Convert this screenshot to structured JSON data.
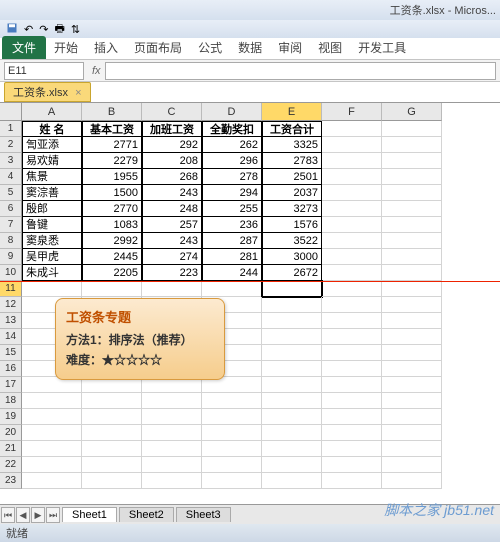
{
  "window": {
    "title": "工资条.xlsx - Micros..."
  },
  "ribbon": {
    "file": "文件",
    "tabs": [
      "开始",
      "插入",
      "页面布局",
      "公式",
      "数据",
      "审阅",
      "视图",
      "开发工具"
    ]
  },
  "namebox": "E11",
  "fx": "fx",
  "workbook_tab": "工资条.xlsx",
  "columns": [
    "A",
    "B",
    "C",
    "D",
    "E",
    "F",
    "G"
  ],
  "headers": [
    "姓  名",
    "基本工资",
    "加班工资",
    "全勤奖扣",
    "工资合计"
  ],
  "rows": [
    {
      "n": "訇亚添",
      "a": 2771,
      "b": 292,
      "c": 262,
      "d": 3325
    },
    {
      "n": "易欢婧",
      "a": 2279,
      "b": 208,
      "c": 296,
      "d": 2783
    },
    {
      "n": "焦景",
      "a": 1955,
      "b": 268,
      "c": 278,
      "d": 2501
    },
    {
      "n": "窦淙善",
      "a": 1500,
      "b": 243,
      "c": 294,
      "d": 2037
    },
    {
      "n": "殷郎",
      "a": 2770,
      "b": 248,
      "c": 255,
      "d": 3273
    },
    {
      "n": "鲁键",
      "a": 1083,
      "b": 257,
      "c": 236,
      "d": 1576
    },
    {
      "n": "窦泉悉",
      "a": 2992,
      "b": 243,
      "c": 287,
      "d": 3522
    },
    {
      "n": "吴甲虎",
      "a": 2445,
      "b": 274,
      "c": 281,
      "d": 3000
    },
    {
      "n": "朱成斗",
      "a": 2205,
      "b": 223,
      "c": 244,
      "d": 2672
    }
  ],
  "note": {
    "title": "工资条专题",
    "l1": "方法1：排序法（推荐）",
    "l2": "难度：★☆☆☆☆"
  },
  "sheets": [
    "Sheet1",
    "Sheet2",
    "Sheet3"
  ],
  "status": "就绪",
  "watermark": "脚本之家 jb51.net",
  "selected": {
    "col": "E",
    "row": 11
  },
  "chart_data": {
    "type": "table",
    "title": "工资条",
    "columns": [
      "姓名",
      "基本工资",
      "加班工资",
      "全勤奖扣",
      "工资合计"
    ],
    "data": [
      [
        "訇亚添",
        2771,
        292,
        262,
        3325
      ],
      [
        "易欢婧",
        2279,
        208,
        296,
        2783
      ],
      [
        "焦景",
        1955,
        268,
        278,
        2501
      ],
      [
        "窦淙善",
        1500,
        243,
        294,
        2037
      ],
      [
        "殷郎",
        2770,
        248,
        255,
        3273
      ],
      [
        "鲁键",
        1083,
        257,
        236,
        1576
      ],
      [
        "窦泉悉",
        2992,
        243,
        287,
        3522
      ],
      [
        "吴甲虎",
        2445,
        274,
        281,
        3000
      ],
      [
        "朱成斗",
        2205,
        223,
        244,
        2672
      ]
    ]
  }
}
